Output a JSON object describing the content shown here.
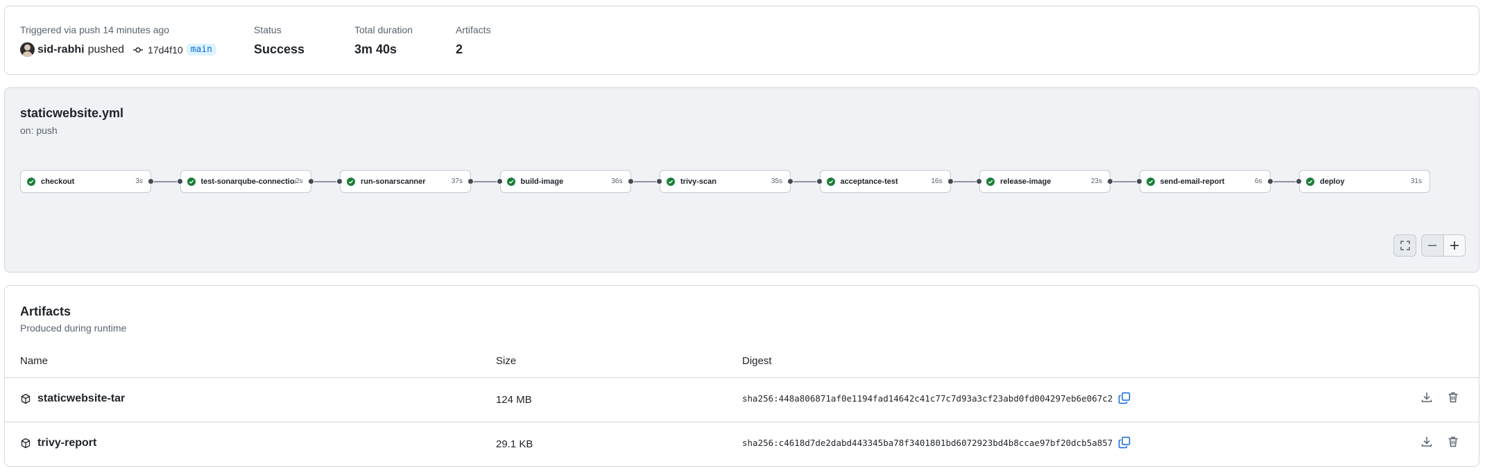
{
  "summary": {
    "triggered_label": "Triggered via push 14 minutes ago",
    "actor": "sid-rabhi",
    "action": "pushed",
    "commit_sha": "17d4f10",
    "branch": "main",
    "status_label": "Status",
    "status_value": "Success",
    "duration_label": "Total duration",
    "duration_value": "3m 40s",
    "artifacts_label": "Artifacts",
    "artifacts_value": "2"
  },
  "workflow": {
    "file": "staticwebsite.yml",
    "trigger": "on: push",
    "jobs": [
      {
        "name": "checkout",
        "duration": "3s",
        "status": "success"
      },
      {
        "name": "test-sonarqube-connection",
        "duration": "2s",
        "status": "success"
      },
      {
        "name": "run-sonarscanner",
        "duration": "37s",
        "status": "success"
      },
      {
        "name": "build-image",
        "duration": "36s",
        "status": "success"
      },
      {
        "name": "trivy-scan",
        "duration": "35s",
        "status": "success"
      },
      {
        "name": "acceptance-test",
        "duration": "16s",
        "status": "success"
      },
      {
        "name": "release-image",
        "duration": "23s",
        "status": "success"
      },
      {
        "name": "send-email-report",
        "duration": "6s",
        "status": "success"
      },
      {
        "name": "deploy",
        "duration": "31s",
        "status": "success"
      }
    ]
  },
  "artifacts": {
    "title": "Artifacts",
    "subtitle": "Produced during runtime",
    "columns": {
      "name": "Name",
      "size": "Size",
      "digest": "Digest"
    },
    "rows": [
      {
        "name": "staticwebsite-tar",
        "size": "124 MB",
        "digest": "sha256:448a806871af0e1194fad14642c41c77c7d93a3cf23abd0fd004297eb6e067c2"
      },
      {
        "name": "trivy-report",
        "size": "29.1 KB",
        "digest": "sha256:c4618d7de2dabd443345ba78f3401801bd6072923bd4b8ccae97bf20dcb5a857"
      }
    ]
  },
  "colors": {
    "success": "#1a7f37",
    "branch_bg": "#ddf4ff",
    "branch_fg": "#0969da",
    "graph_bg": "#f0f2f5",
    "border": "#d0d7de"
  },
  "icons": {
    "avatar": "user-avatar",
    "commit": "git-commit-icon",
    "job_status": "check-circle-fill-icon",
    "fullscreen": "screen-full-icon",
    "zoom_out": "dash-icon",
    "zoom_in": "plus-icon",
    "artifact": "package-icon",
    "copy": "copy-icon",
    "download": "download-icon",
    "delete": "trash-icon"
  }
}
